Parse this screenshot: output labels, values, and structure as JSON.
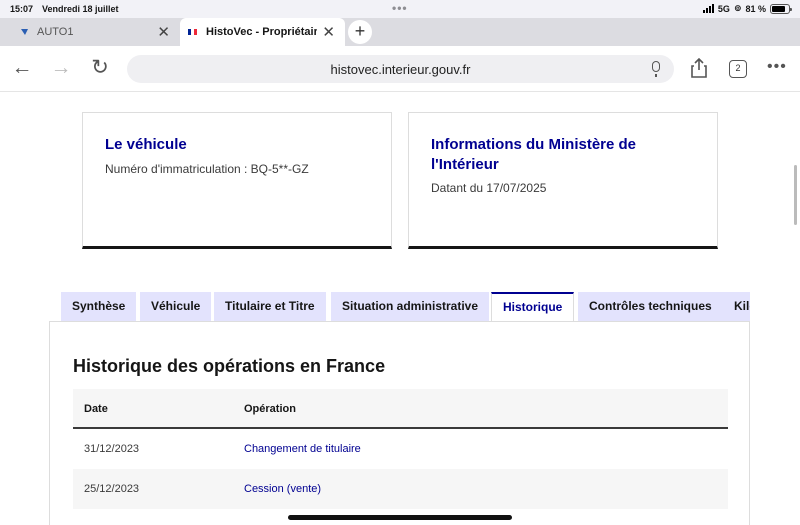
{
  "status": {
    "time": "15:07",
    "date": "Vendredi 18 juillet",
    "network": "5G",
    "battery": "81 %"
  },
  "browser_tabs": [
    {
      "title": "AUTO1",
      "active": false
    },
    {
      "title": "HistoVec - Propriétaire",
      "active": true
    }
  ],
  "toolbar": {
    "url": "histovec.interieur.gouv.fr",
    "tab_count": "2"
  },
  "cards": {
    "vehicle": {
      "title": "Le véhicule",
      "plate": "Numéro d'immatriculation : BQ-5**-GZ"
    },
    "ministry": {
      "title": "Informations du Ministère de l'Intérieur",
      "date": "Datant du 17/07/2025"
    }
  },
  "page_tabs": [
    {
      "label": "Synthèse",
      "active": false
    },
    {
      "label": "Véhicule",
      "active": false
    },
    {
      "label": "Titulaire et Titre",
      "active": false
    },
    {
      "label": "Situation administrative",
      "active": false
    },
    {
      "label": "Historique",
      "active": true
    },
    {
      "label": "Contrôles techniques",
      "active": false
    },
    {
      "label": "Kilométrage",
      "active": false
    }
  ],
  "history": {
    "title": "Historique des opérations en France",
    "columns": [
      "Date",
      "Opération"
    ],
    "rows": [
      {
        "date": "31/12/2023",
        "operation": "Changement de titulaire"
      },
      {
        "date": "25/12/2023",
        "operation": "Cession (vente)"
      }
    ]
  },
  "colors": {
    "accent": "#000091",
    "tab_bg": "#e3e3fd"
  }
}
